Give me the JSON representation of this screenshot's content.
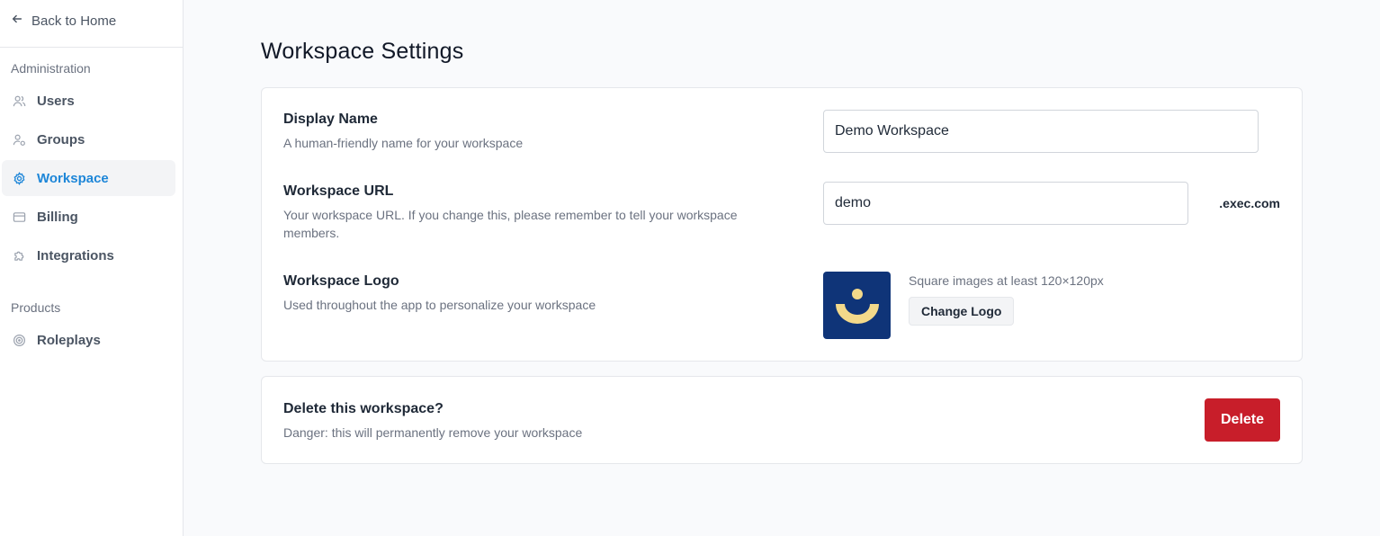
{
  "sidebar": {
    "back_label": "Back to Home",
    "sections": [
      {
        "label": "Administration",
        "items": [
          {
            "label": "Users",
            "icon": "users-icon",
            "active": false
          },
          {
            "label": "Groups",
            "icon": "groups-icon",
            "active": false
          },
          {
            "label": "Workspace",
            "icon": "gear-icon",
            "active": true
          },
          {
            "label": "Billing",
            "icon": "credit-card-icon",
            "active": false
          },
          {
            "label": "Integrations",
            "icon": "puzzle-icon",
            "active": false
          }
        ]
      },
      {
        "label": "Products",
        "items": [
          {
            "label": "Roleplays",
            "icon": "target-icon",
            "active": false
          }
        ]
      }
    ]
  },
  "main": {
    "title": "Workspace Settings",
    "display_name": {
      "title": "Display Name",
      "description": "A human-friendly name for your workspace",
      "value": "Demo Workspace"
    },
    "workspace_url": {
      "title": "Workspace URL",
      "description": "Your workspace URL. If you change this, please remember to tell your workspace members.",
      "value": "demo",
      "suffix": ".exec.com"
    },
    "workspace_logo": {
      "title": "Workspace Logo",
      "description": "Used throughout the app to personalize your workspace",
      "hint": "Square images at least 120×120px",
      "button_label": "Change Logo"
    },
    "danger": {
      "title": "Delete this workspace?",
      "description": "Danger: this will permanently remove your workspace",
      "button_label": "Delete"
    }
  },
  "colors": {
    "accent": "#1d86d8",
    "danger": "#c81e2a",
    "logo_bg": "#0f3478",
    "logo_fg": "#f3d98a"
  }
}
